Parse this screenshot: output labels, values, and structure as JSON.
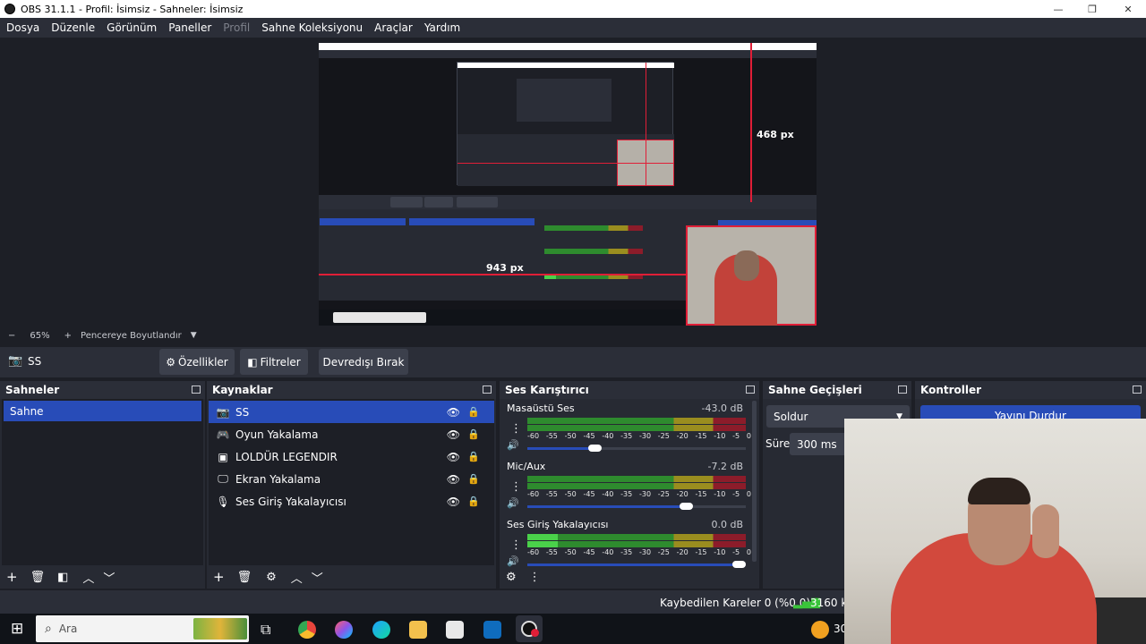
{
  "window": {
    "title": "OBS 31.1.1 - Profil: İsimsiz - Sahneler: İsimsiz",
    "min_glyph": "—",
    "max_glyph": "❐",
    "close_glyph": "✕"
  },
  "menu": [
    {
      "label": "Dosya",
      "enabled": true
    },
    {
      "label": "Düzenle",
      "enabled": true
    },
    {
      "label": "Görünüm",
      "enabled": true
    },
    {
      "label": "Paneller",
      "enabled": true
    },
    {
      "label": "Profil",
      "enabled": false
    },
    {
      "label": "Sahne Koleksiyonu",
      "enabled": true
    },
    {
      "label": "Araçlar",
      "enabled": true
    },
    {
      "label": "Yardım",
      "enabled": true
    }
  ],
  "preview": {
    "measure_vertical": "468 px",
    "measure_horizontal": "943 px"
  },
  "zoom": {
    "minus": "−",
    "value": "65%",
    "plus": "+",
    "fit_label": "Pencereye Boyutlandır",
    "caret": "▼"
  },
  "source_toolbar": {
    "icon": "camera-icon",
    "name": "SS",
    "properties": "Özellikler",
    "filters": "Filtreler",
    "deactivate": "Devredışı Bırak"
  },
  "scenes": {
    "title": "Sahneler",
    "items": [
      "Sahne"
    ],
    "selected": 0
  },
  "sources": {
    "title": "Kaynaklar",
    "items": [
      {
        "name": "SS",
        "icon": "camera-icon",
        "glyph": "📷",
        "selected": true
      },
      {
        "name": "Oyun Yakalama",
        "icon": "gamepad-icon",
        "glyph": "🎮",
        "selected": false
      },
      {
        "name": "LOLDÜR LEGENDIR",
        "icon": "window-icon",
        "glyph": "▣",
        "selected": false
      },
      {
        "name": "Ekran Yakalama",
        "icon": "monitor-icon",
        "glyph": "🖵",
        "selected": false
      },
      {
        "name": "Ses Giriş Yakalayıcısı",
        "icon": "microphone-icon",
        "glyph": "🎙",
        "selected": false
      }
    ]
  },
  "mixer": {
    "title": "Ses Karıştırıcı",
    "tick_labels": [
      "-60",
      "-55",
      "-50",
      "-45",
      "-40",
      "-35",
      "-30",
      "-25",
      "-20",
      "-15",
      "-10",
      "-5",
      "0"
    ],
    "channels": [
      {
        "name": "Masaüstü Ses",
        "db": "-43.0 dB",
        "level_fraction": 0.0,
        "volume_fraction": 0.29
      },
      {
        "name": "Mic/Aux",
        "db": "-7.2 dB",
        "level_fraction": 0.0,
        "volume_fraction": 0.72
      },
      {
        "name": "Ses Giriş Yakalayıcısı",
        "db": "0.0 dB",
        "level_fraction": 0.14,
        "volume_fraction": 0.97
      }
    ]
  },
  "transitions": {
    "title": "Sahne Geçişleri",
    "selected": "Soldur",
    "duration_label": "Süre",
    "duration_value": "300 ms"
  },
  "controls": {
    "title": "Kontroller",
    "stop_stream": "Yayını Durdur"
  },
  "status": {
    "dropped_frames": "Kaybedilen Kareler 0 (%0.0)",
    "bitrate": "3160 kb"
  },
  "taskbar": {
    "search_placeholder": "Ara",
    "temp": "30"
  },
  "colors": {
    "accent": "#284cb8",
    "meter_green": "#2e8b2e",
    "meter_yellow": "#9a8d1f",
    "meter_red": "#8c1c2a",
    "live_red": "#e01e37"
  }
}
